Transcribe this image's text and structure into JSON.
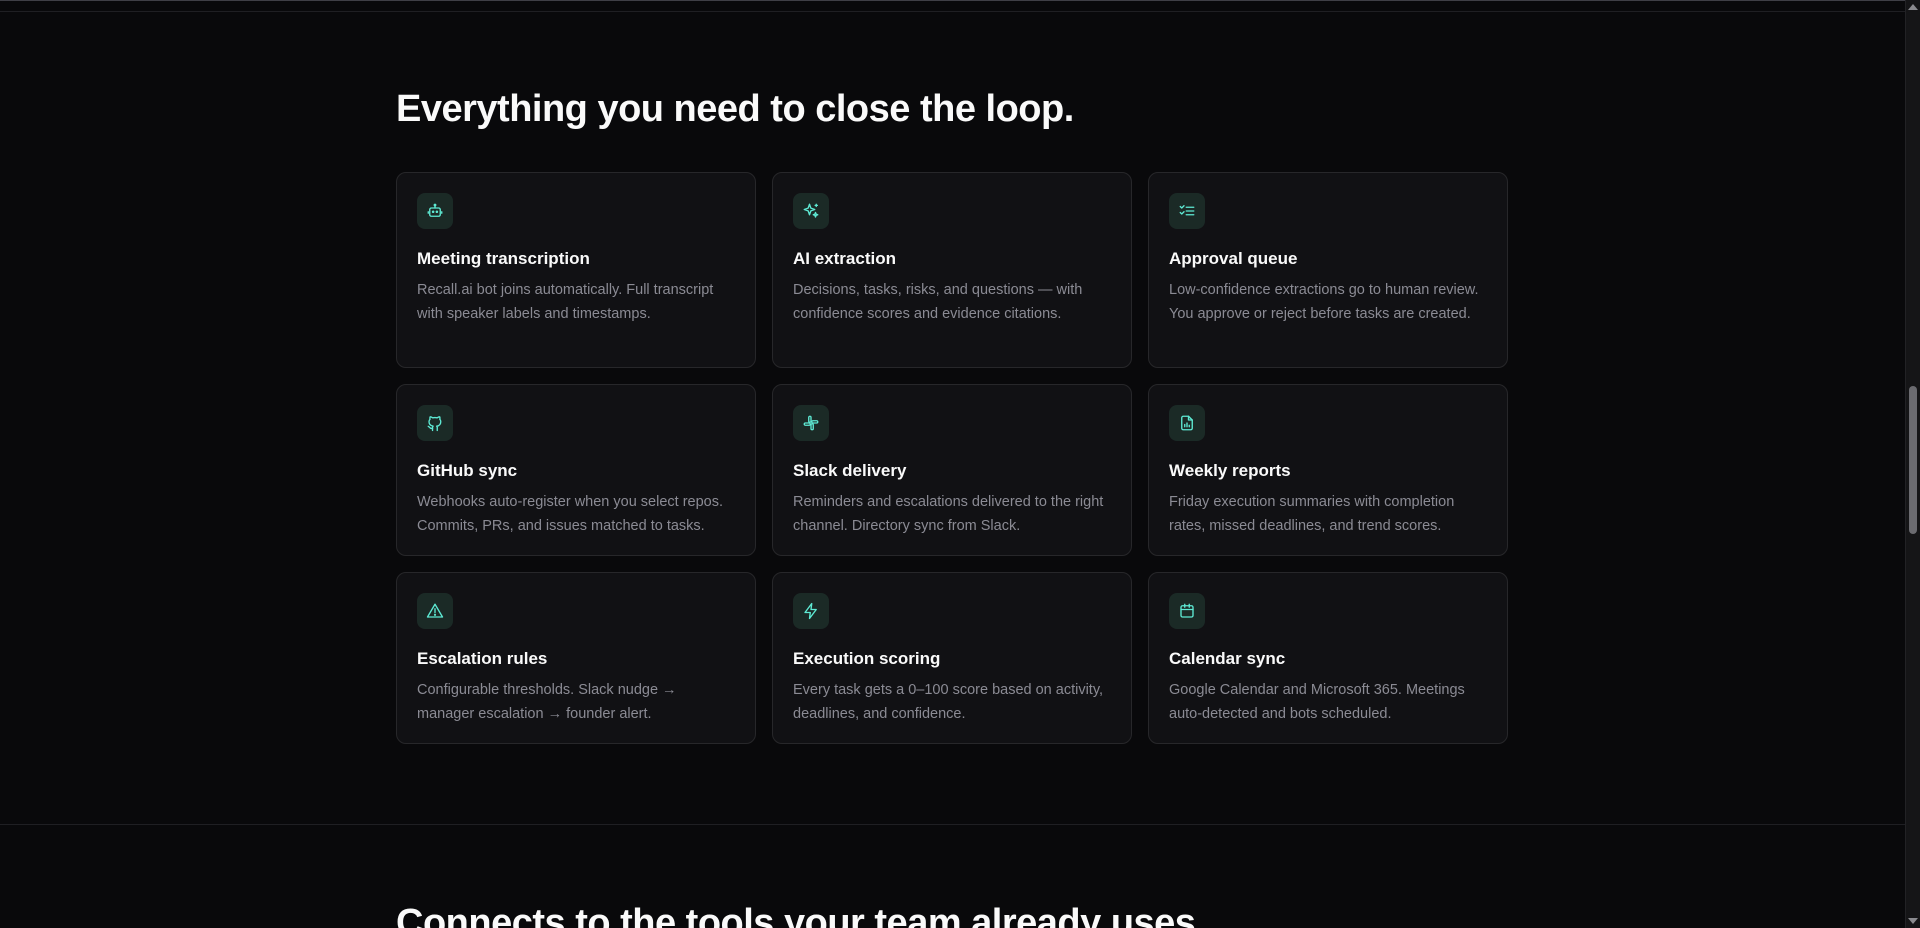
{
  "features": {
    "title": "Everything you need to close the loop.",
    "items": [
      {
        "icon": "bot-icon",
        "title": "Meeting transcription",
        "desc": "Recall.ai bot joins automatically. Full transcript with speaker labels and timestamps."
      },
      {
        "icon": "sparkles-icon",
        "title": "AI extraction",
        "desc": "Decisions, tasks, risks, and questions — with confidence scores and evidence citations."
      },
      {
        "icon": "checklist-icon",
        "title": "Approval queue",
        "desc": "Low-confidence extractions go to human review. You approve or reject before tasks are created."
      },
      {
        "icon": "github-icon",
        "title": "GitHub sync",
        "desc": "Webhooks auto-register when you select repos. Commits, PRs, and issues matched to tasks."
      },
      {
        "icon": "slack-icon",
        "title": "Slack delivery",
        "desc": "Reminders and escalations delivered to the right channel. Directory sync from Slack."
      },
      {
        "icon": "report-icon",
        "title": "Weekly reports",
        "desc": "Friday execution summaries with completion rates, missed deadlines, and trend scores."
      },
      {
        "icon": "alert-triangle-icon",
        "title": "Escalation rules",
        "desc": "Configurable thresholds. Slack nudge → manager escalation → founder alert."
      },
      {
        "icon": "lightning-icon",
        "title": "Execution scoring",
        "desc": "Every task gets a 0–100 score based on activity, deadlines, and confidence."
      },
      {
        "icon": "calendar-icon",
        "title": "Calendar sync",
        "desc": "Google Calendar and Microsoft 365. Meetings auto-detected and bots scheduled."
      }
    ]
  },
  "integrations": {
    "title": "Connects to the tools your team already uses."
  },
  "colors": {
    "background": "#09090b",
    "card": "#111114",
    "accent": "#5eead4"
  }
}
